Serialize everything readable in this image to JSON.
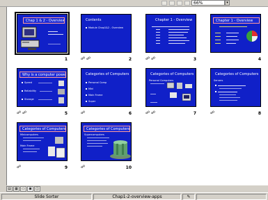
{
  "toolbar": {
    "zoom_value": "66%",
    "zoom_arrow": "▾"
  },
  "slides": [
    {
      "num": "1",
      "title": "Chap 1 & 2 - Overview, Apps",
      "trans": ""
    },
    {
      "num": "2",
      "title": "Contents",
      "trans": "☍ ☍"
    },
    {
      "num": "3",
      "title": "Chapter 1 - Overview",
      "trans": "☍ ☍"
    },
    {
      "num": "4",
      "title": "Chapter 1 - Overview",
      "trans": "☍"
    },
    {
      "num": "5",
      "title": "Why is a computer powerful?",
      "trans": "☍ ☍"
    },
    {
      "num": "6",
      "title": "Categories of Computers",
      "trans": "☍"
    },
    {
      "num": "7",
      "title": "Categories of Computers",
      "trans": "☍ ☍"
    },
    {
      "num": "8",
      "title": "Categories of Computers",
      "trans": "☍"
    },
    {
      "num": "9",
      "title": "Categories of Computers",
      "trans": "☍"
    },
    {
      "num": "10",
      "title": "Categories of Computers",
      "trans": "☍"
    }
  ],
  "slide_text": {
    "s2_line": "Module Chap1&2 - Overview",
    "s5_items": [
      "Speed",
      "Reliability",
      "Storage"
    ],
    "s6_items": [
      "Personal Comp",
      "Mini",
      "Main Frame",
      "Super"
    ],
    "s7_sub": "Personal Computers",
    "s8_sub": "Servers",
    "s9_sub1": "Minicomputers",
    "s9_sub2": "Main Frame",
    "s10_sub": "Supercomputers"
  },
  "view_buttons": [
    "▤",
    "▦",
    "▭",
    "▣",
    "◫"
  ],
  "status": {
    "view": "Slide Sorter",
    "file": "Chap1-2-overview-apps",
    "icon": "✎"
  }
}
